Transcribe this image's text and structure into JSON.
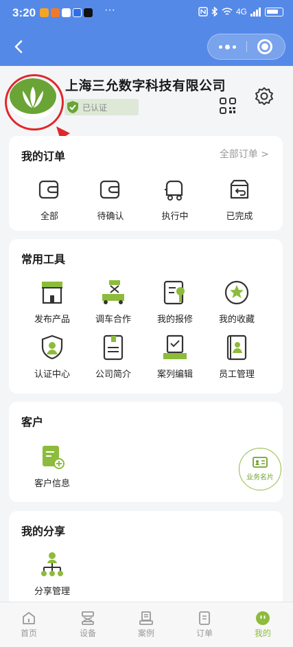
{
  "status_bar": {
    "time": "3:20",
    "dots": "···",
    "net": "4G"
  },
  "nav": {
    "back_icon": "chevron-left-icon",
    "more_icon": "more-dots-icon",
    "close_icon": "target-icon"
  },
  "profile": {
    "company_name": "上海三允数字科技有限公司",
    "verified_label": "已认证"
  },
  "orders": {
    "title": "我的订单",
    "all_link": "全部订单 >",
    "items": [
      {
        "label": "全部",
        "icon": "wallet-icon"
      },
      {
        "label": "待确认",
        "icon": "wallet-icon"
      },
      {
        "label": "执行中",
        "icon": "truck-icon"
      },
      {
        "label": "已完成",
        "icon": "box-return-icon"
      }
    ]
  },
  "tools": {
    "title": "常用工具",
    "items": [
      {
        "label": "发布产品",
        "icon": "shop-icon"
      },
      {
        "label": "调车合作",
        "icon": "scissor-lift-icon"
      },
      {
        "label": "我的报修",
        "icon": "repair-icon"
      },
      {
        "label": "我的收藏",
        "icon": "star-icon"
      },
      {
        "label": "认证中心",
        "icon": "shield-check-icon"
      },
      {
        "label": "公司简介",
        "icon": "document-icon"
      },
      {
        "label": "案列编辑",
        "icon": "edit-case-icon"
      },
      {
        "label": "员工管理",
        "icon": "staff-icon"
      }
    ]
  },
  "customers": {
    "title": "客户",
    "items": [
      {
        "label": "客户信息",
        "icon": "customer-add-icon"
      }
    ]
  },
  "business_card": {
    "label": "业务名片"
  },
  "share": {
    "title": "我的分享",
    "items": [
      {
        "label": "分享管理",
        "icon": "org-chart-icon"
      }
    ]
  },
  "tabbar": {
    "items": [
      {
        "label": "首页",
        "icon": "home-icon"
      },
      {
        "label": "设备",
        "icon": "equipment-icon"
      },
      {
        "label": "案例",
        "icon": "case-icon"
      },
      {
        "label": "订单",
        "icon": "order-icon"
      },
      {
        "label": "我的",
        "icon": "profile-face-icon"
      }
    ],
    "active": "我的"
  },
  "colors": {
    "accent": "#8dbb3b",
    "header": "#5589e8",
    "icon_dark": "#333333",
    "annotation": "#e0272a"
  }
}
